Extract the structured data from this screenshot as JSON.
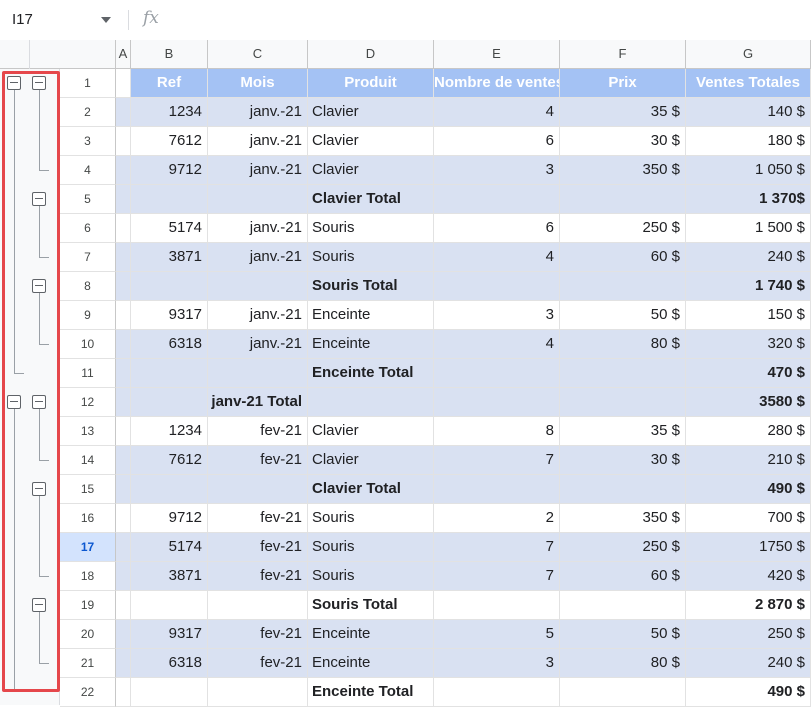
{
  "formula_bar": {
    "name_box": "I17",
    "fx_label": "fx"
  },
  "columns": [
    "A",
    "B",
    "C",
    "D",
    "E",
    "F",
    "G"
  ],
  "header_row": {
    "row": "1",
    "cells": [
      "",
      "Ref",
      "Mois",
      "Produit",
      "Nombre de ventes",
      "Prix",
      "Ventes Totales"
    ]
  },
  "rows": [
    {
      "row": "2",
      "cells": [
        "",
        "1234",
        "janv.-21",
        "Clavier",
        "4",
        "35 $",
        "140 $"
      ]
    },
    {
      "row": "3",
      "cells": [
        "",
        "7612",
        "janv.-21",
        "Clavier",
        "6",
        "30 $",
        "180 $"
      ]
    },
    {
      "row": "4",
      "cells": [
        "",
        "9712",
        "janv.-21",
        "Clavier",
        "3",
        "350 $",
        "1 050 $"
      ]
    },
    {
      "row": "5",
      "cells": [
        "",
        "",
        "",
        "Clavier Total",
        "",
        "",
        "1 370$"
      ]
    },
    {
      "row": "6",
      "cells": [
        "",
        "5174",
        "janv.-21",
        "Souris",
        "6",
        "250 $",
        "1 500 $"
      ]
    },
    {
      "row": "7",
      "cells": [
        "",
        "3871",
        "janv.-21",
        "Souris",
        "4",
        "60 $",
        "240 $"
      ]
    },
    {
      "row": "8",
      "cells": [
        "",
        "",
        "",
        "Souris Total",
        "",
        "",
        "1 740 $"
      ]
    },
    {
      "row": "9",
      "cells": [
        "",
        "9317",
        "janv.-21",
        "Enceinte",
        "3",
        "50 $",
        "150 $"
      ]
    },
    {
      "row": "10",
      "cells": [
        "",
        "6318",
        "janv.-21",
        "Enceinte",
        "4",
        "80 $",
        "320 $"
      ]
    },
    {
      "row": "11",
      "cells": [
        "",
        "",
        "",
        "Enceinte Total",
        "",
        "",
        "470 $"
      ]
    },
    {
      "row": "12",
      "cells": [
        "",
        "",
        "janv-21 Total",
        "",
        "",
        "",
        "3580 $"
      ]
    },
    {
      "row": "13",
      "cells": [
        "",
        "1234",
        "fev-21",
        "Clavier",
        "8",
        "35 $",
        "280 $"
      ]
    },
    {
      "row": "14",
      "cells": [
        "",
        "7612",
        "fev-21",
        "Clavier",
        "7",
        "30 $",
        "210 $"
      ]
    },
    {
      "row": "15",
      "cells": [
        "",
        "",
        "",
        "Clavier Total",
        "",
        "",
        "490 $"
      ]
    },
    {
      "row": "16",
      "cells": [
        "",
        "9712",
        "fev-21",
        "Souris",
        "2",
        "350 $",
        "700 $"
      ]
    },
    {
      "row": "17",
      "cells": [
        "",
        "5174",
        "fev-21",
        "Souris",
        "7",
        "250 $",
        "1750 $"
      ]
    },
    {
      "row": "18",
      "cells": [
        "",
        "3871",
        "fev-21",
        "Souris",
        "7",
        "60 $",
        "420 $"
      ]
    },
    {
      "row": "19",
      "cells": [
        "",
        "",
        "",
        "Souris Total",
        "",
        "",
        "2 870 $"
      ]
    },
    {
      "row": "20",
      "cells": [
        "",
        "9317",
        "fev-21",
        "Enceinte",
        "5",
        "50 $",
        "250 $"
      ]
    },
    {
      "row": "21",
      "cells": [
        "",
        "6318",
        "fev-21",
        "Enceinte",
        "3",
        "80 $",
        "240 $"
      ]
    },
    {
      "row": "22",
      "cells": [
        "",
        "",
        "",
        "Enceinte Total",
        "",
        "",
        "490 $"
      ]
    }
  ],
  "banded_rows": [
    "2",
    "4",
    "5",
    "7",
    "8",
    "10",
    "11",
    "12",
    "14",
    "15",
    "17",
    "18",
    "20",
    "21"
  ],
  "bold_rows": [
    "5",
    "8",
    "11",
    "12",
    "15",
    "19",
    "22"
  ],
  "selected_row": "17",
  "colors": {
    "header_fill": "#a4c2f4",
    "band_fill": "#d9e1f2",
    "highlight_border": "#e5474b",
    "selected_row_header": "#d3e3fd"
  }
}
